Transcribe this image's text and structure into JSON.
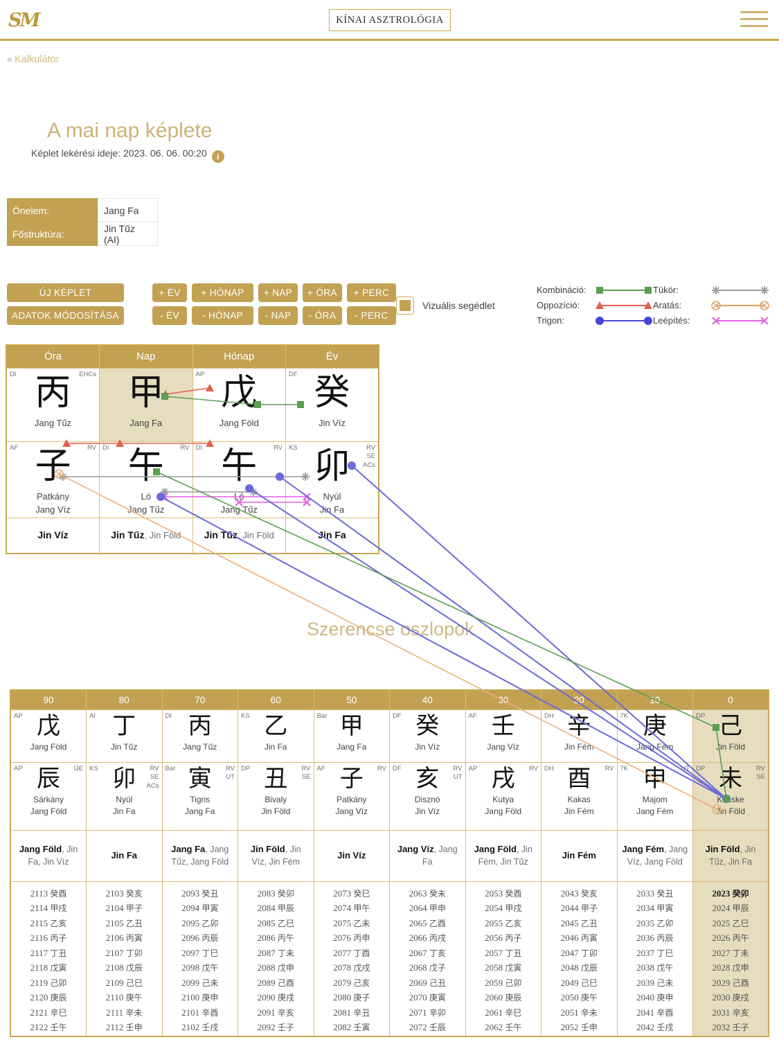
{
  "header": {
    "logo_text": "SM",
    "title": "KÍNAI ASZTROLÓGIA",
    "menu_icon": "hamburger-menu-icon"
  },
  "breadcrumb": {
    "chevron": "«",
    "label": "Kalkulátor"
  },
  "page": {
    "title": "A mai nap képlete",
    "subtitle": "Képlet lekérési ideje: 2023. 06. 06. 00:20",
    "info_icon": "info-icon"
  },
  "self_table": {
    "rows": [
      {
        "label": "Önelem:",
        "value": "Jang Fa"
      },
      {
        "label": "Főstruktúra:",
        "value": "Jin Tűz (AI)"
      }
    ]
  },
  "buttons": {
    "new_formula": "ÚJ KÉPLET",
    "edit_data": "ADATOK MÓDOSÍTÁSA",
    "plus": [
      "+ ÉV",
      "+ HÓNAP",
      "+ NAP",
      "+ ÓRA",
      "+ PERC"
    ],
    "minus": [
      "- ÉV",
      "- HÓNAP",
      "- NAP",
      "- ÓRA",
      "- PERC"
    ]
  },
  "visual_aid": {
    "label": "Vizuális segédlet",
    "checked": true,
    "color": "#c2a153"
  },
  "legend": [
    {
      "label": "Kombináció:",
      "color": "#5a9e53",
      "marker": "square"
    },
    {
      "label": "Oppozíció:",
      "color": "#e2604d",
      "marker": "triangle"
    },
    {
      "label": "Trigon:",
      "color": "#4646d8",
      "marker": "circle"
    },
    {
      "label": "Tükör:",
      "color": "#9a9a9a",
      "marker": "asterisk"
    },
    {
      "label": "Aratás:",
      "color": "#e0a062",
      "marker": "crossed-circle"
    },
    {
      "label": "Leépítés:",
      "color": "#e45fe4",
      "marker": "x"
    }
  ],
  "chart": {
    "headers": [
      "Óra",
      "Nap",
      "Hónap",
      "Év"
    ],
    "stems": [
      {
        "han": "丙",
        "name": "Jang Tűz",
        "tl": "DI",
        "tr": "EHCs",
        "highlight": false
      },
      {
        "han": "甲",
        "name": "Jang Fa",
        "tl": "",
        "tr": "",
        "highlight": true
      },
      {
        "han": "戊",
        "name": "Jang Föld",
        "tl": "AP",
        "tr": "",
        "highlight": false
      },
      {
        "han": "癸",
        "name": "Jin Víz",
        "tl": "DF",
        "tr": "",
        "highlight": false
      }
    ],
    "branches": [
      {
        "han": "子",
        "animal": "Patkány",
        "name": "Jang Víz",
        "tl": "AF",
        "tr": "RV"
      },
      {
        "han": "午",
        "animal": "Ló",
        "name": "Jang Tűz",
        "tl": "DI",
        "tr": "RV"
      },
      {
        "han": "午",
        "animal": "Ló",
        "name": "Jang Tűz",
        "tl": "DI",
        "tr": "RV"
      },
      {
        "han": "卯",
        "animal": "Nyúl",
        "name": "Jin Fa",
        "tl": "KS",
        "tr": "RV\nSE\nACs"
      }
    ],
    "elements": [
      {
        "main": "Jin Víz",
        "sub": ""
      },
      {
        "main": "Jin Tűz",
        "sub": ", Jin Föld"
      },
      {
        "main": "Jin Tűz",
        "sub": ", Jin Föld"
      },
      {
        "main": "Jin Fa",
        "sub": ""
      }
    ]
  },
  "luck_section_title": "Szerencse oszlopok",
  "luck": {
    "headers": [
      "90",
      "80",
      "70",
      "60",
      "50",
      "40",
      "30",
      "20",
      "10",
      "0"
    ],
    "stems": [
      {
        "han": "戊",
        "name": "Jang Föld",
        "tl": "AP",
        "tr": "",
        "highlight": false
      },
      {
        "han": "丁",
        "name": "Jin Tűz",
        "tl": "AI",
        "tr": "",
        "highlight": false
      },
      {
        "han": "丙",
        "name": "Jang Tűz",
        "tl": "DI",
        "tr": "",
        "highlight": false
      },
      {
        "han": "乙",
        "name": "Jin Fa",
        "tl": "KS",
        "tr": "",
        "highlight": false
      },
      {
        "han": "甲",
        "name": "Jang Fa",
        "tl": "Bar",
        "tr": "",
        "highlight": false
      },
      {
        "han": "癸",
        "name": "Jin Víz",
        "tl": "DF",
        "tr": "",
        "highlight": false
      },
      {
        "han": "壬",
        "name": "Jang Víz",
        "tl": "AF",
        "tr": "",
        "highlight": false
      },
      {
        "han": "辛",
        "name": "Jin Fém",
        "tl": "DH",
        "tr": "",
        "highlight": false
      },
      {
        "han": "庚",
        "name": "Jang Fém",
        "tl": "7K",
        "tr": "",
        "highlight": false
      },
      {
        "han": "己",
        "name": "Jin Föld",
        "tl": "DP",
        "tr": "",
        "highlight": true
      }
    ],
    "branches": [
      {
        "han": "辰",
        "animal": "Sárkány",
        "name": "Jang Föld",
        "tl": "AP",
        "tr": "ÜE",
        "highlight": false
      },
      {
        "han": "卯",
        "animal": "Nyúl",
        "name": "Jin Fa",
        "tl": "KS",
        "tr": "RV\nSE\nACs",
        "highlight": false
      },
      {
        "han": "寅",
        "animal": "Tigris",
        "name": "Jang Fa",
        "tl": "Bar",
        "tr": "RV\nUT",
        "highlight": false
      },
      {
        "han": "丑",
        "animal": "Bivaly",
        "name": "Jin Föld",
        "tl": "DP",
        "tr": "RV\nSE",
        "highlight": false
      },
      {
        "han": "子",
        "animal": "Patkány",
        "name": "Jang Víz",
        "tl": "AF",
        "tr": "RV",
        "highlight": false
      },
      {
        "han": "亥",
        "animal": "Disznó",
        "name": "Jin Víz",
        "tl": "DF",
        "tr": "RV\nUT",
        "highlight": false
      },
      {
        "han": "戌",
        "animal": "Kutya",
        "name": "Jang Föld",
        "tl": "AP",
        "tr": "RV",
        "highlight": false
      },
      {
        "han": "酉",
        "animal": "Kakas",
        "name": "Jin Fém",
        "tl": "DH",
        "tr": "RV",
        "highlight": false
      },
      {
        "han": "申",
        "animal": "Majom",
        "name": "Jang Fém",
        "tl": "7K",
        "tr": "UT",
        "highlight": false
      },
      {
        "han": "未",
        "animal": "Kecske",
        "name": "Jin Föld",
        "tl": "DP",
        "tr": "RV\nSE",
        "highlight": true
      }
    ],
    "elements": [
      {
        "main": "Jang Föld",
        "sub": ", Jin Fa, Jin Víz",
        "highlight": false
      },
      {
        "main": "Jin Fa",
        "sub": "",
        "highlight": false
      },
      {
        "main": "Jang Fa",
        "sub": ", Jang Tűz, Jang Föld",
        "highlight": false
      },
      {
        "main": "Jin Föld",
        "sub": ", Jin Víz, Jin Fém",
        "highlight": false
      },
      {
        "main": "Jin Víz",
        "sub": "",
        "highlight": false
      },
      {
        "main": "Jang Víz",
        "sub": ", Jang Fa",
        "highlight": false
      },
      {
        "main": "Jang Föld",
        "sub": ", Jin Fém, Jin Tűz",
        "highlight": false
      },
      {
        "main": "Jin Fém",
        "sub": "",
        "highlight": false
      },
      {
        "main": "Jang Fém",
        "sub": ", Jang Víz, Jang Föld",
        "highlight": false
      },
      {
        "main": "Jin Föld",
        "sub": ", Jin Tűz, Jin Fa",
        "highlight": true
      }
    ],
    "years": [
      [
        "2113 癸酉",
        "2114 甲戌",
        "2115 乙亥",
        "2116 丙子",
        "2117 丁丑",
        "2118 戊寅",
        "2119 己卯",
        "2120 庚辰",
        "2121 辛巳",
        "2122 壬午"
      ],
      [
        "2103 癸亥",
        "2104 甲子",
        "2105 乙丑",
        "2106 丙寅",
        "2107 丁卯",
        "2108 戊辰",
        "2109 己巳",
        "2110 庚午",
        "2111 辛未",
        "2112 壬申"
      ],
      [
        "2093 癸丑",
        "2094 甲寅",
        "2095 乙卯",
        "2096 丙辰",
        "2097 丁巳",
        "2098 戊午",
        "2099 己未",
        "2100 庚申",
        "2101 辛酉",
        "2102 壬戌"
      ],
      [
        "2083 癸卯",
        "2084 甲辰",
        "2085 乙巳",
        "2086 丙午",
        "2087 丁未",
        "2088 戊申",
        "2089 己酉",
        "2090 庚戌",
        "2091 辛亥",
        "2092 壬子"
      ],
      [
        "2073 癸巳",
        "2074 甲午",
        "2075 乙未",
        "2076 丙申",
        "2077 丁酉",
        "2078 戊戌",
        "2079 己亥",
        "2080 庚子",
        "2081 辛丑",
        "2082 壬寅"
      ],
      [
        "2063 癸未",
        "2064 甲申",
        "2065 乙酉",
        "2066 丙戌",
        "2067 丁亥",
        "2068 戊子",
        "2069 己丑",
        "2070 庚寅",
        "2071 辛卯",
        "2072 壬辰"
      ],
      [
        "2053 癸酉",
        "2054 甲戌",
        "2055 乙亥",
        "2056 丙子",
        "2057 丁丑",
        "2058 戊寅",
        "2059 己卯",
        "2060 庚辰",
        "2061 辛巳",
        "2062 壬午"
      ],
      [
        "2043 癸亥",
        "2044 甲子",
        "2045 乙丑",
        "2046 丙寅",
        "2047 丁卯",
        "2048 戊辰",
        "2049 己巳",
        "2050 庚午",
        "2051 辛未",
        "2052 壬申"
      ],
      [
        "2033 癸丑",
        "2034 甲寅",
        "2035 乙卯",
        "2036 丙辰",
        "2037 丁巳",
        "2038 戊午",
        "2039 己未",
        "2040 庚申",
        "2041 辛酉",
        "2042 壬戌"
      ],
      [
        "2023 癸卯",
        "2024 甲辰",
        "2025 乙巳",
        "2026 丙午",
        "2027 丁未",
        "2028 戊申",
        "2029 己酉",
        "2030 庚戌",
        "2031 辛亥",
        "2032 壬子"
      ]
    ],
    "current_year": "2023"
  }
}
